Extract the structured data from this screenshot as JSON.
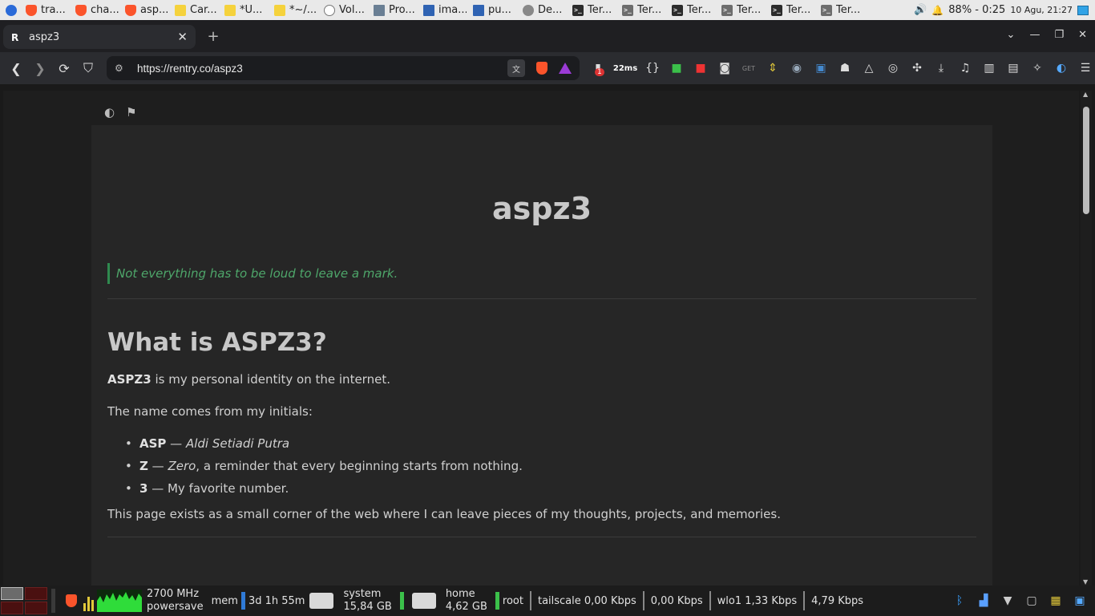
{
  "taskbar": {
    "tasks": [
      {
        "icon": "brave-icon",
        "label": "tra..."
      },
      {
        "icon": "brave-icon",
        "label": "cha..."
      },
      {
        "icon": "brave-icon",
        "label": "asp..."
      },
      {
        "icon": "note-icon",
        "label": "Car..."
      },
      {
        "icon": "note-icon",
        "label": "*U..."
      },
      {
        "icon": "note-icon",
        "label": "*~/..."
      },
      {
        "icon": "volume-app-icon",
        "label": "Vol..."
      },
      {
        "icon": "folder-icon",
        "label": "Pro..."
      },
      {
        "icon": "folder-icon",
        "label": "ima..."
      },
      {
        "icon": "folder-icon",
        "label": "pu..."
      },
      {
        "icon": "disk-icon",
        "label": "De..."
      },
      {
        "icon": "terminal-icon",
        "label": "Ter..."
      },
      {
        "icon": "terminal-icon",
        "label": "Ter..."
      },
      {
        "icon": "terminal-icon",
        "label": "Ter..."
      },
      {
        "icon": "terminal-icon",
        "label": "Ter..."
      },
      {
        "icon": "terminal-icon",
        "label": "Ter..."
      },
      {
        "icon": "terminal-icon",
        "label": "Ter..."
      }
    ],
    "battery": "88% - 0:25",
    "clock": "10 Agu, 21:27"
  },
  "browser": {
    "tab_title": "aspz3",
    "tab_favicon": "R",
    "url": "https://rentry.co/aspz3",
    "ext_badge": "1",
    "ext_ping": "22ms"
  },
  "page": {
    "title": "aspz3",
    "quote": "Not everything has to be loud to leave a mark.",
    "heading": "What is ASPZ3?",
    "p1_bold": "ASPZ3",
    "p1_rest": " is my personal identity on the internet.",
    "p2": "The name comes from my initials:",
    "list": [
      {
        "bold": "ASP",
        "sep": " — ",
        "italic": "Aldi Setiadi Putra",
        "rest": ""
      },
      {
        "bold": "Z",
        "sep": " — ",
        "italic": "Zero",
        "rest": ", a reminder that every beginning starts from nothing."
      },
      {
        "bold": "3",
        "sep": " — ",
        "italic": "",
        "rest": "My favorite number."
      }
    ],
    "p3": "This page exists as a small corner of the web where I can leave pieces of my thoughts, projects, and memories."
  },
  "panel": {
    "cpu_freq": "2700 MHz",
    "cpu_gov": "powersave",
    "mem_label": "mem",
    "uptime": "3d 1h 55m",
    "disk_system_label": "system",
    "disk_system_free": "15,84 GB",
    "disk_home_label": "home",
    "disk_home_free": "4,62 GB",
    "user": "root",
    "net_tailscale": "tailscale 0,00 Kbps",
    "net_tailscale2": "0,00 Kbps",
    "net_wlo1": "wlo1 1,33 Kbps",
    "net_wlo1_2": "4,79 Kbps"
  },
  "colors": {
    "accent_green": "#4ea66a",
    "brave": "#fb542b"
  }
}
